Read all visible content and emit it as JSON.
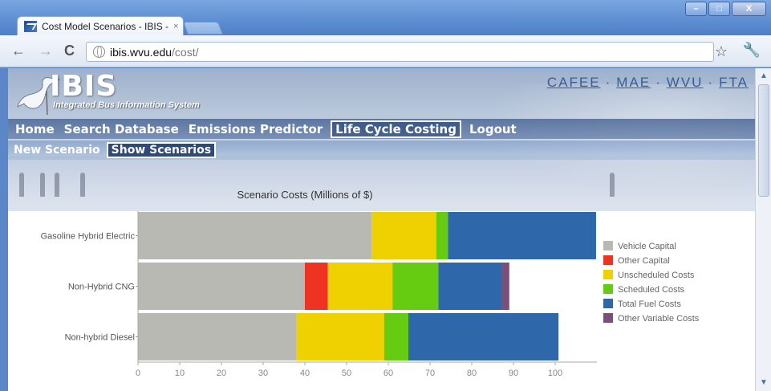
{
  "browser": {
    "tab_title": "Cost Model Scenarios - IBIS -",
    "tab_close": "×",
    "url_host": "ibis.wvu.edu",
    "url_path": "/cost/",
    "window_buttons": {
      "minimize": "–",
      "maximize": "□",
      "close": "X"
    },
    "icons": {
      "back": "back-arrow-icon",
      "forward": "forward-arrow-icon",
      "reload": "reload-icon",
      "bookmark": "star-icon",
      "menu": "wrench-icon"
    }
  },
  "site": {
    "logo": "IBIS",
    "logo_subtitle": "Integrated Bus Information System",
    "partner_links": [
      "CAFEE",
      "MAE",
      "WVU",
      "FTA"
    ],
    "main_nav": [
      {
        "label": "Home",
        "active": false
      },
      {
        "label": "Search Database",
        "active": false
      },
      {
        "label": "Emissions Predictor",
        "active": false
      },
      {
        "label": "Life Cycle Costing",
        "active": true
      },
      {
        "label": "Logout",
        "active": false
      }
    ],
    "sub_nav": [
      {
        "label": "New Scenario",
        "active": false
      },
      {
        "label": "Show Scenarios",
        "active": true
      }
    ]
  },
  "chart_data": {
    "type": "bar",
    "orientation": "horizontal",
    "stacked": true,
    "title": "Scenario Costs (Millions of $)",
    "categories": [
      "Gasoline Hybrid Electric",
      "Non-Hybrid CNG",
      "Non-hybrid Diesel"
    ],
    "series": [
      {
        "name": "Vehicle Capital",
        "color": "#b8b9b3",
        "values": [
          56,
          40,
          38
        ]
      },
      {
        "name": "Other Capital",
        "color": "#ee3322",
        "values": [
          0,
          5.5,
          0
        ]
      },
      {
        "name": "Unscheduled Costs",
        "color": "#efd000",
        "values": [
          15.5,
          15.5,
          21
        ]
      },
      {
        "name": "Scheduled Costs",
        "color": "#66cc11",
        "values": [
          2.8,
          11,
          5.8
        ]
      },
      {
        "name": "Total Fuel Costs",
        "color": "#2f68aa",
        "values": [
          35.5,
          15.3,
          36
        ]
      },
      {
        "name": "Other Variable Costs",
        "color": "#7a4f7a",
        "values": [
          0,
          1.7,
          0
        ]
      }
    ],
    "xlim": [
      0,
      110
    ],
    "xticks": [
      0,
      10,
      20,
      30,
      40,
      50,
      60,
      70,
      80,
      90,
      100
    ],
    "legend_position": "right"
  }
}
